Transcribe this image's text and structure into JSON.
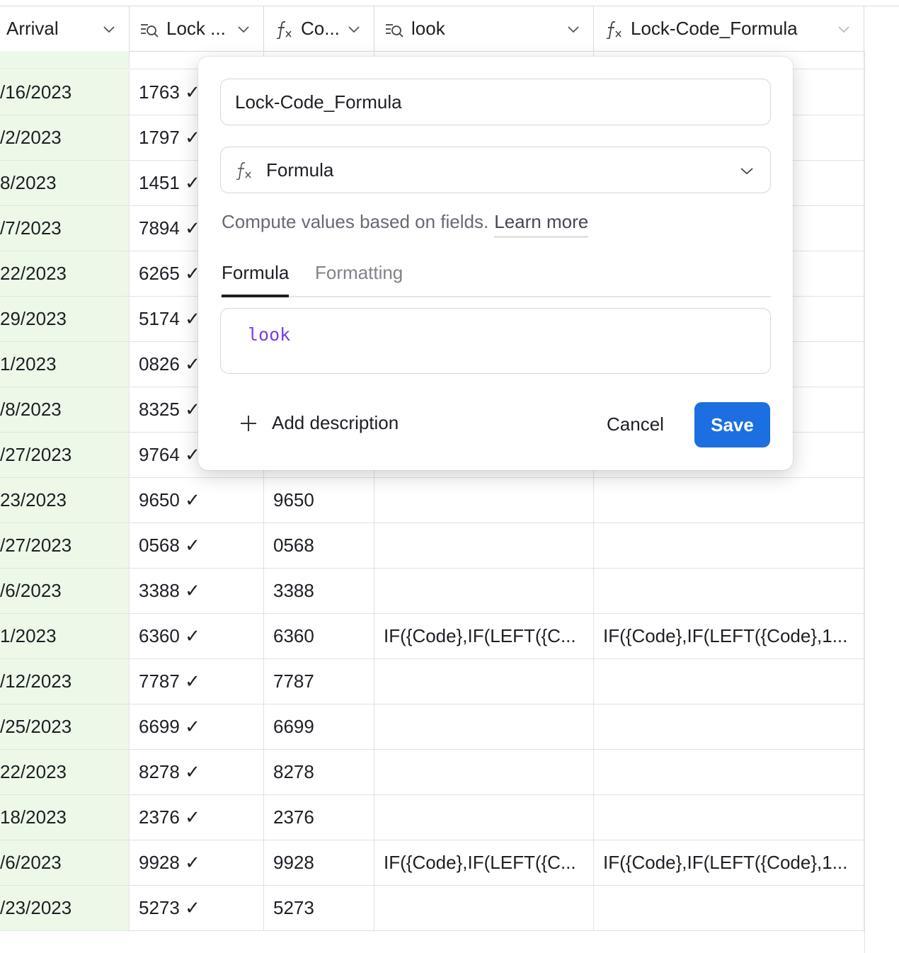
{
  "columns": {
    "arrival": "Arrival",
    "lock": "Lock ...",
    "code": "Co...",
    "look": "look",
    "formula": "Lock-Code_Formula"
  },
  "rows": [
    {
      "arrival": "/16/2023",
      "lock": "1763 ✓",
      "code": "",
      "look": "",
      "formula": ""
    },
    {
      "arrival": "/2/2023",
      "lock": "1797 ✓",
      "code": "",
      "look": "",
      "formula": ""
    },
    {
      "arrival": "8/2023",
      "lock": "1451 ✓",
      "code": "",
      "look": "",
      "formula": ""
    },
    {
      "arrival": "/7/2023",
      "lock": "7894 ✓",
      "code": "",
      "look": "",
      "formula": ""
    },
    {
      "arrival": "22/2023",
      "lock": "6265 ✓",
      "code": "",
      "look": "",
      "formula": ""
    },
    {
      "arrival": "29/2023",
      "lock": "5174 ✓",
      "code": "",
      "look": "",
      "formula": ""
    },
    {
      "arrival": "1/2023",
      "lock": "0826 ✓",
      "code": "",
      "look": "",
      "formula": ""
    },
    {
      "arrival": "/8/2023",
      "lock": "8325 ✓",
      "code": "",
      "look": "",
      "formula": ""
    },
    {
      "arrival": "/27/2023",
      "lock": "9764 ✓",
      "code": "",
      "look": "",
      "formula": ""
    },
    {
      "arrival": "23/2023",
      "lock": "9650 ✓",
      "code": "9650",
      "look": "",
      "formula": ""
    },
    {
      "arrival": "/27/2023",
      "lock": "0568 ✓",
      "code": "0568",
      "look": "",
      "formula": ""
    },
    {
      "arrival": "/6/2023",
      "lock": "3388 ✓",
      "code": "3388",
      "look": "",
      "formula": ""
    },
    {
      "arrival": "1/2023",
      "lock": "6360 ✓",
      "code": "6360",
      "look": "IF({Code},IF(LEFT({C...",
      "formula": "IF({Code},IF(LEFT({Code},1..."
    },
    {
      "arrival": "/12/2023",
      "lock": "7787 ✓",
      "code": "7787",
      "look": "",
      "formula": ""
    },
    {
      "arrival": "/25/2023",
      "lock": "6699 ✓",
      "code": "6699",
      "look": "",
      "formula": ""
    },
    {
      "arrival": "22/2023",
      "lock": "8278 ✓",
      "code": "8278",
      "look": "",
      "formula": ""
    },
    {
      "arrival": "18/2023",
      "lock": "2376 ✓",
      "code": "2376",
      "look": "",
      "formula": ""
    },
    {
      "arrival": "/6/2023",
      "lock": "9928 ✓",
      "code": "9928",
      "look": "IF({Code},IF(LEFT({C...",
      "formula": "IF({Code},IF(LEFT({Code},1..."
    },
    {
      "arrival": "/23/2023",
      "lock": "5273 ✓",
      "code": "5273",
      "look": "",
      "formula": ""
    }
  ],
  "popover": {
    "field_name": "Lock-Code_Formula",
    "field_type": "Formula",
    "description": "Compute values based on fields.",
    "learn_more": "Learn more",
    "tab_formula": "Formula",
    "tab_formatting": "Formatting",
    "formula_text": "look",
    "add_description": "Add description",
    "cancel": "Cancel",
    "save": "Save"
  },
  "colors": {
    "accent": "#1b6fe0",
    "arrival_bg": "#edf9e8",
    "formula_token": "#7b3fe4"
  },
  "icons": {
    "lookup": "lookup-icon",
    "formula": "formula-icon",
    "chevron": "chevron-down-icon",
    "plus": "plus-icon"
  }
}
